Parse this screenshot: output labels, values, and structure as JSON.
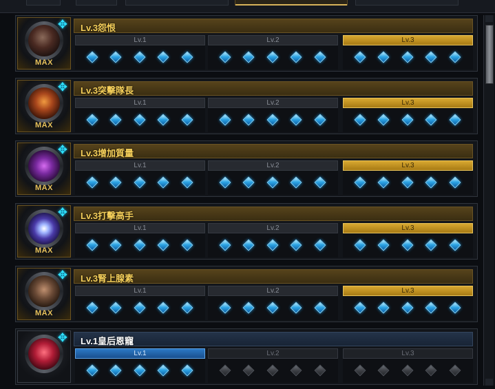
{
  "rows": [
    {
      "title": "Lv.3怨恨",
      "max": "MAX",
      "art": "a0",
      "active_level": 3,
      "levels": [
        {
          "label": "Lv.1",
          "filled": 5
        },
        {
          "label": "Lv.2",
          "filled": 5
        },
        {
          "label": "Lv.3",
          "filled": 5
        }
      ]
    },
    {
      "title": "Lv.3突擊隊長",
      "max": "MAX",
      "art": "a1",
      "active_level": 3,
      "levels": [
        {
          "label": "Lv.1",
          "filled": 5
        },
        {
          "label": "Lv.2",
          "filled": 5
        },
        {
          "label": "Lv.3",
          "filled": 5
        }
      ]
    },
    {
      "title": "Lv.3增加質量",
      "max": "MAX",
      "art": "a2",
      "active_level": 3,
      "levels": [
        {
          "label": "Lv.1",
          "filled": 5
        },
        {
          "label": "Lv.2",
          "filled": 5
        },
        {
          "label": "Lv.3",
          "filled": 5
        }
      ]
    },
    {
      "title": "Lv.3打擊高手",
      "max": "MAX",
      "art": "a3",
      "active_level": 3,
      "levels": [
        {
          "label": "Lv.1",
          "filled": 5
        },
        {
          "label": "Lv.2",
          "filled": 5
        },
        {
          "label": "Lv.3",
          "filled": 5
        }
      ]
    },
    {
      "title": "Lv.3腎上腺素",
      "max": "MAX",
      "art": "a4",
      "active_level": 3,
      "levels": [
        {
          "label": "Lv.1",
          "filled": 5
        },
        {
          "label": "Lv.2",
          "filled": 5
        },
        {
          "label": "Lv.3",
          "filled": 5
        }
      ]
    },
    {
      "title": "Lv.1皇后恩寵",
      "max": "",
      "art": "a5",
      "active_level": 1,
      "levels": [
        {
          "label": "Lv.1",
          "filled": 5
        },
        {
          "label": "Lv.2",
          "filled": 0
        },
        {
          "label": "Lv.3",
          "filled": 0
        }
      ]
    }
  ],
  "icons": {
    "plus": "cross-star-icon",
    "gem": "diamond-gem-icon"
  },
  "colors": {
    "gold": "#f5cf5a",
    "blue_gem": "#2fa6e6",
    "plus": "#2fe2ff"
  }
}
